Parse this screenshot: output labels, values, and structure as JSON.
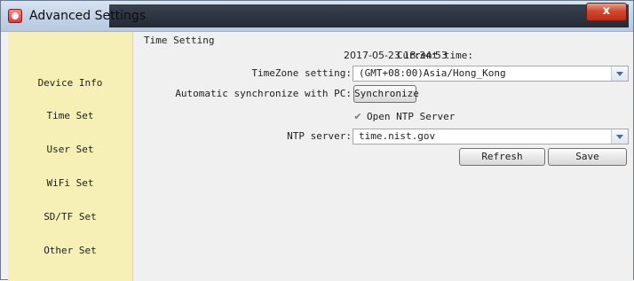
{
  "window": {
    "title": "Advanced Settings",
    "close_glyph": "x"
  },
  "sidebar": {
    "items": [
      {
        "label": "Device Info"
      },
      {
        "label": "Time Set"
      },
      {
        "label": "User Set"
      },
      {
        "label": "WiFi Set"
      },
      {
        "label": "SD/TF Set"
      },
      {
        "label": "Other Set"
      }
    ]
  },
  "time_setting": {
    "section_title": "Time Setting",
    "current_time_label": "Current time:",
    "current_time_value": "2017-05-23 18:34:53",
    "timezone_label": "TimeZone setting:",
    "timezone_value": "(GMT+08:00)Asia/Hong_Kong",
    "sync_label": "Automatic synchronize with PC:",
    "sync_button": "Synchronize",
    "ntp_checkbox_label": "Open NTP Server",
    "ntp_checkbox_checked": true,
    "ntp_server_label": "NTP server:",
    "ntp_server_value": "time.nist.gov",
    "refresh_button": "Refresh",
    "save_button": "Save"
  },
  "icons": {
    "app": "app-logo-icon",
    "close": "close-icon",
    "dropdown": "chevron-down-icon",
    "check": "checkmark-icon"
  },
  "colors": {
    "sidebar_bg": "#f6f0b6",
    "titlebar_dark": "#242a35",
    "close_red": "#c9361c"
  }
}
